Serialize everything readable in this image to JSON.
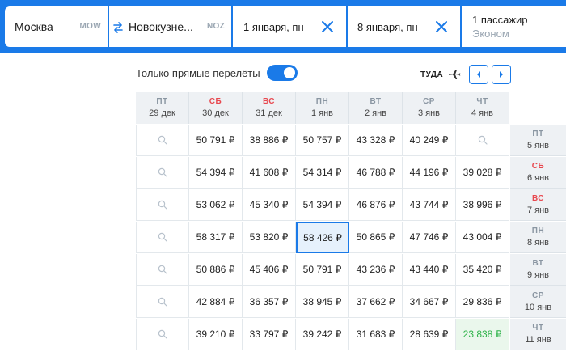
{
  "search": {
    "from_city": "Москва",
    "from_code": "MOW",
    "to_city": "Новокузне...",
    "to_code": "NOZ",
    "depart_date": "1 января, пн",
    "return_date": "8 января, пн",
    "passengers": "1 пассажир",
    "cabin_class": "Эконом"
  },
  "filter": {
    "direct_label": "Только прямые перелёты",
    "direct_on": true
  },
  "direction": {
    "label": "ТУДА"
  },
  "columns": [
    {
      "dow": "ПТ",
      "date": "29 дек",
      "weekend": false
    },
    {
      "dow": "СБ",
      "date": "30 дек",
      "weekend": true
    },
    {
      "dow": "ВС",
      "date": "31 дек",
      "weekend": true
    },
    {
      "dow": "ПН",
      "date": "1 янв",
      "weekend": false
    },
    {
      "dow": "ВТ",
      "date": "2 янв",
      "weekend": false
    },
    {
      "dow": "СР",
      "date": "3 янв",
      "weekend": false
    },
    {
      "dow": "ЧТ",
      "date": "4 янв",
      "weekend": false
    }
  ],
  "rows": [
    {
      "dow": "ПТ",
      "date": "5 янв",
      "weekend": false,
      "prices": [
        "",
        "50 791 ₽",
        "38 886 ₽",
        "50 757 ₽",
        "43 328 ₽",
        "40 249 ₽",
        ""
      ]
    },
    {
      "dow": "СБ",
      "date": "6 янв",
      "weekend": true,
      "prices": [
        "",
        "54 394 ₽",
        "41 608 ₽",
        "54 314 ₽",
        "46 788 ₽",
        "44 196 ₽",
        "39 028 ₽"
      ]
    },
    {
      "dow": "ВС",
      "date": "7 янв",
      "weekend": true,
      "prices": [
        "",
        "53 062 ₽",
        "45 340 ₽",
        "54 394 ₽",
        "46 876 ₽",
        "43 744 ₽",
        "38 996 ₽"
      ]
    },
    {
      "dow": "ПН",
      "date": "8 янв",
      "weekend": false,
      "prices": [
        "",
        "58 317 ₽",
        "53 820 ₽",
        "58 426 ₽",
        "50 865 ₽",
        "47 746 ₽",
        "43 004 ₽"
      ]
    },
    {
      "dow": "ВТ",
      "date": "9 янв",
      "weekend": false,
      "prices": [
        "",
        "50 886 ₽",
        "45 406 ₽",
        "50 791 ₽",
        "43 236 ₽",
        "43 440 ₽",
        "35 420 ₽"
      ]
    },
    {
      "dow": "СР",
      "date": "10 янв",
      "weekend": false,
      "prices": [
        "",
        "42 884 ₽",
        "36 357 ₽",
        "38 945 ₽",
        "37 662 ₽",
        "34 667 ₽",
        "29 836 ₽"
      ]
    },
    {
      "dow": "ЧТ",
      "date": "11 янв",
      "weekend": false,
      "prices": [
        "",
        "39 210 ₽",
        "33 797 ₽",
        "39 242 ₽",
        "31 683 ₽",
        "28 639 ₽",
        "23 838 ₽"
      ]
    }
  ],
  "selected": {
    "row": 3,
    "col": 3
  },
  "cheapest": {
    "row": 6,
    "col": 6
  },
  "colors": {
    "accent": "#1a7ae8",
    "weekend": "#e8484f",
    "cheap": "#2fb34a"
  }
}
